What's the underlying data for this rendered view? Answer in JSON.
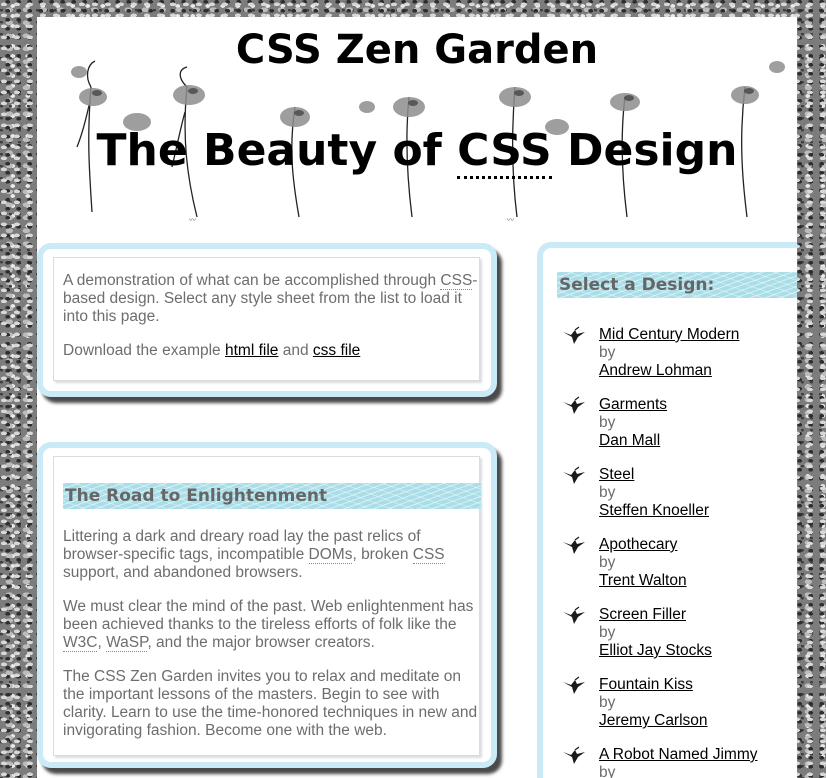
{
  "header": {
    "site_title": "CSS Zen Garden",
    "tagline_prefix": "The Beauty of ",
    "tagline_abbr": "CSS",
    "tagline_suffix": " Design"
  },
  "intro": {
    "p1_text_a": "A demonstration of what can be accomplished through",
    "p1_abbr": "CSS",
    "p1_text_b": "-based design. Select any style sheet from the list to load it into this page.",
    "p2_prefix": "Download the example ",
    "html_file_link": "html file",
    "p2_middle": " and ",
    "css_file_link": "css file"
  },
  "road": {
    "heading": "The Road to Enlightenment",
    "p1_a": "Littering a dark and dreary road lay the past relics of browser-specific tags, incompatible ",
    "p1_doms": "DOMs",
    "p1_b": ", broken ",
    "p1_css": "CSS",
    "p1_c": " support, and abandoned browsers.",
    "p2_a": "We must clear the mind of the past. Web enlightenment has been achieved thanks to the tireless efforts of folk like the ",
    "p2_w3c": "W3C",
    "p2_b": ", ",
    "p2_wasp": "WaSP",
    "p2_c": ", and the major browser creators.",
    "p3": "The CSS Zen Garden invites you to relax and meditate on the important lessons of the masters. Begin to see with clarity. Learn to use the time-honored techniques in new and invigorating fashion. Become one with the web."
  },
  "sidebar": {
    "heading": "Select a Design:",
    "by_label": "by",
    "designs": [
      {
        "name": "Mid Century Modern",
        "designer": "Andrew Lohman"
      },
      {
        "name": "Garments",
        "designer": "Dan Mall"
      },
      {
        "name": "Steel",
        "designer": "Steffen Knoeller"
      },
      {
        "name": "Apothecary",
        "designer": "Trent Walton"
      },
      {
        "name": "Screen Filler",
        "designer": "Elliot Jay Stocks"
      },
      {
        "name": "Fountain Kiss",
        "designer": "Jeremy Carlson"
      },
      {
        "name": "A Robot Named Jimmy",
        "designer": ""
      }
    ],
    "icon": "bird-icon"
  },
  "colors": {
    "box_border": "#cbeaf8",
    "ribbon": "#a9dde8",
    "body_text": "#6d6d6d"
  }
}
